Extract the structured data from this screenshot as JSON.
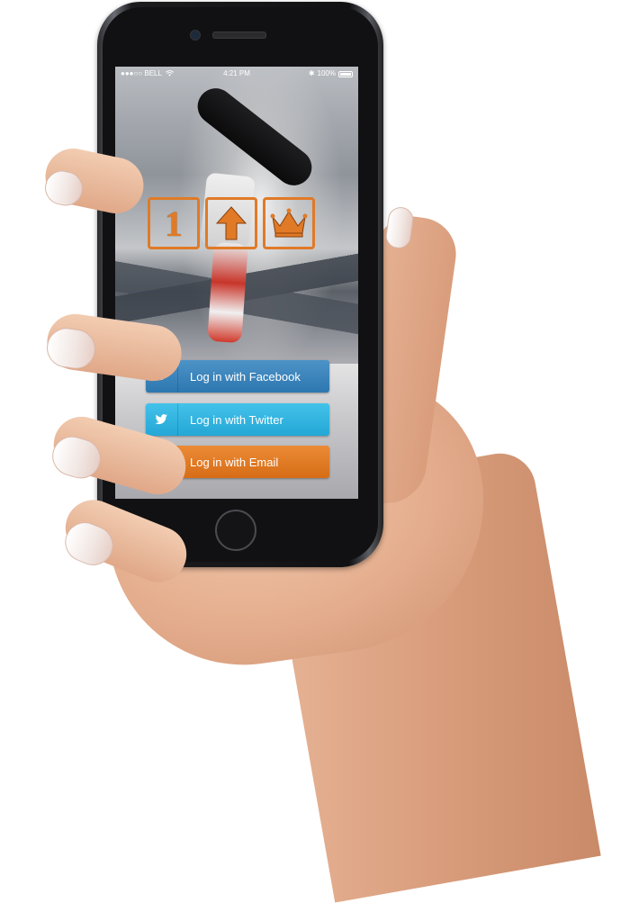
{
  "status_bar": {
    "carrier": "●●●○○ BELL",
    "time": "4:21 PM",
    "battery": "100%"
  },
  "logo": {
    "tile_1_text": "1",
    "tile_2_icon": "arrow-up-icon",
    "tile_3_icon": "crown-icon",
    "accent_color": "#e07a27"
  },
  "login": {
    "facebook_label": "Log in with Facebook",
    "twitter_label": "Log in with Twitter",
    "email_label": "Log in with Email",
    "facebook_color": "#3b83bd",
    "twitter_color": "#34b4e0",
    "email_color": "#e07a27"
  }
}
